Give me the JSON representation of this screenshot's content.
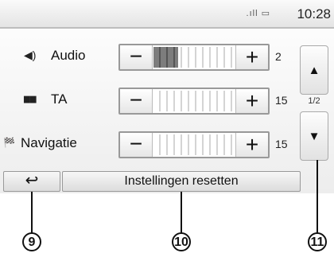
{
  "status_bar": {
    "signal_icons": ".ıll ▭",
    "time": "10:28"
  },
  "rows": [
    {
      "icon": "speaker-icon",
      "icon_glyph": "◀)",
      "label": "Audio",
      "value": "2",
      "level": 0.3
    },
    {
      "icon": "ta-icon",
      "icon_glyph": "▆▆",
      "label": "TA",
      "value": "15",
      "level": 0.0
    },
    {
      "icon": "checkered-flag-icon",
      "icon_glyph": "🏁",
      "label": "Navigatie",
      "value": "15",
      "level": 0.0
    }
  ],
  "controls": {
    "minus": "−",
    "plus": "+"
  },
  "scroll": {
    "up": "▲",
    "down": "▼",
    "page": "1/2"
  },
  "bottom": {
    "back_glyph": "↩",
    "reset_label": "Instellingen resetten"
  },
  "callouts": [
    "9",
    "10",
    "11"
  ]
}
